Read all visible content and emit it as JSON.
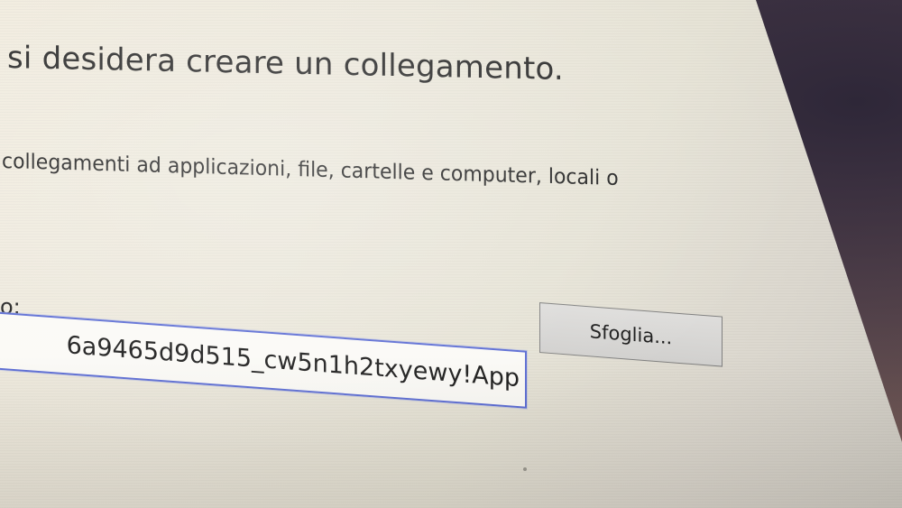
{
  "dialog": {
    "heading": "si desidera creare un collegamento.",
    "description": "collegamenti ad applicazioni, file, cartelle e computer, locali o",
    "field_label": "o:",
    "path_value": "6a9465d9d515_cw5n1h2txyewy!App",
    "browse_label": "Sfoglia..."
  },
  "colors": {
    "input_focus_border": "#5a6bd3",
    "window_background": "#ece8dc",
    "button_background": "#d6d5d3"
  }
}
